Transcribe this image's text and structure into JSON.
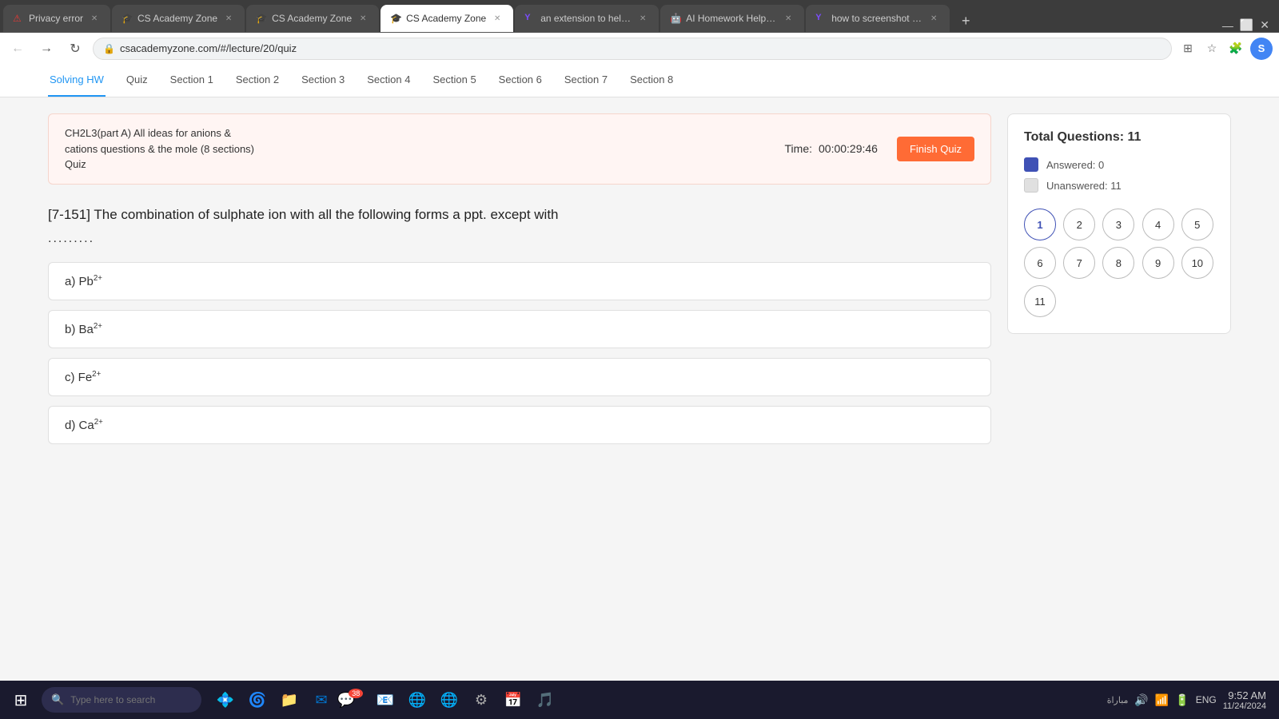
{
  "browser": {
    "tabs": [
      {
        "id": "tab1",
        "title": "Privacy error",
        "favicon": "⚠",
        "active": false,
        "color": "#e53935"
      },
      {
        "id": "tab2",
        "title": "CS Academy Zone",
        "favicon": "🎓",
        "active": false,
        "color": "#4285f4"
      },
      {
        "id": "tab3",
        "title": "CS Academy Zone",
        "favicon": "🎓",
        "active": false,
        "color": "#4285f4"
      },
      {
        "id": "tab4",
        "title": "CS Academy Zone",
        "favicon": "🎓",
        "active": true,
        "color": "#4285f4"
      },
      {
        "id": "tab5",
        "title": "an extension to help w",
        "favicon": "Y",
        "active": false,
        "color": "#7c4dff"
      },
      {
        "id": "tab6",
        "title": "AI Homework Helper &",
        "favicon": "🤖",
        "active": false,
        "color": "#ff6d00"
      },
      {
        "id": "tab7",
        "title": "how to screenshot on",
        "favicon": "Y",
        "active": false,
        "color": "#7c4dff"
      }
    ],
    "address": "csacademyzone.com/#/lecture/20/quiz",
    "profile_initial": "S"
  },
  "page_nav": {
    "items": [
      {
        "label": "Solving HW",
        "active": false
      },
      {
        "label": "Quiz",
        "active": true
      },
      {
        "label": "Section 1",
        "active": false
      },
      {
        "label": "Section 2",
        "active": false
      },
      {
        "label": "Section 3",
        "active": false
      },
      {
        "label": "Section 4",
        "active": false
      },
      {
        "label": "Section 5",
        "active": false
      },
      {
        "label": "Section 6",
        "active": false
      },
      {
        "label": "Section 7",
        "active": false
      },
      {
        "label": "Section 8",
        "active": false
      }
    ]
  },
  "quiz_header": {
    "title_line1": "CH2L3(part A) All ideas for anions &",
    "title_line2": "cations questions & the mole (8 sections)",
    "title_line3": "Quiz",
    "time_label": "Time:",
    "time_value": "00:00:29:46",
    "finish_btn": "Finish Quiz"
  },
  "question": {
    "number": "[7-151]",
    "text": "The combination of sulphate ion with all the following forms a ppt. except with",
    "dots": ".........",
    "options": [
      {
        "label": "a)",
        "element": "Pb",
        "superscript": "2+"
      },
      {
        "label": "b)",
        "element": "Ba",
        "superscript": "2+"
      },
      {
        "label": "c)",
        "element": "Fe",
        "superscript": "2+"
      },
      {
        "label": "d)",
        "element": "Ca",
        "superscript": "2+"
      }
    ]
  },
  "sidebar": {
    "title": "Total Questions: 11",
    "answered_label": "Answered:",
    "answered_count": "0",
    "unanswered_label": "Unanswered:",
    "unanswered_count": "11",
    "question_numbers": [
      1,
      2,
      3,
      4,
      5,
      6,
      7,
      8,
      9,
      10,
      11
    ]
  },
  "taskbar": {
    "search_placeholder": "Type here to search",
    "time": "9:52 AM",
    "date": "11/24/2024",
    "lang": "ENG",
    "notification_label": "مباراة"
  }
}
